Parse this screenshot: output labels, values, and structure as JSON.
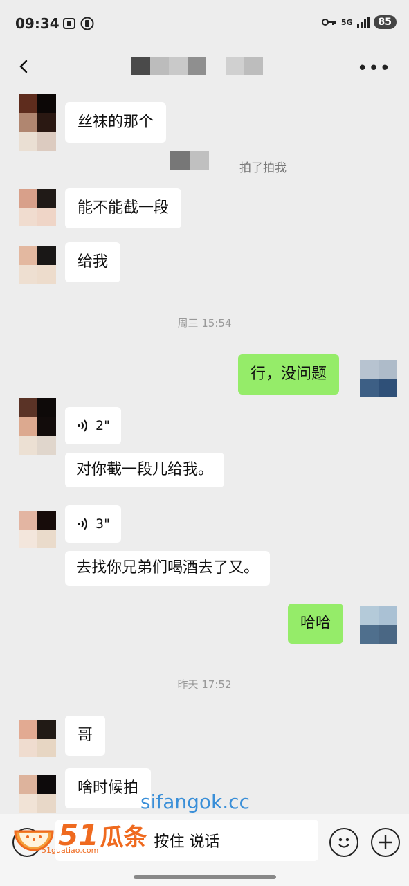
{
  "status": {
    "time": "09:34",
    "network": "5G",
    "battery": "85"
  },
  "header": {
    "title": ""
  },
  "messages": [
    {
      "type": "text",
      "side": "left",
      "text": "丝袜的那个"
    },
    {
      "type": "system",
      "text": "拍了拍我"
    },
    {
      "type": "text",
      "side": "left",
      "text": "能不能截一段"
    },
    {
      "type": "text",
      "side": "left",
      "text": "给我"
    },
    {
      "type": "timestamp",
      "text": "周三 15:54"
    },
    {
      "type": "text",
      "side": "right",
      "text": "行，没问题"
    },
    {
      "type": "voice",
      "side": "left",
      "duration": "2\"",
      "transcript": "对你截一段儿给我。"
    },
    {
      "type": "voice",
      "side": "left",
      "duration": "3\"",
      "transcript": "去找你兄弟们喝酒去了又。"
    },
    {
      "type": "text",
      "side": "right",
      "text": "哈哈"
    },
    {
      "type": "timestamp",
      "text": "昨天 17:52"
    },
    {
      "type": "text",
      "side": "left",
      "text": "哥"
    },
    {
      "type": "text",
      "side": "left",
      "text": "啥时候拍"
    }
  ],
  "input_bar": {
    "hold_to_talk": "按住 说话"
  },
  "watermark": {
    "url": "sifangok.cc",
    "logo_number": "51",
    "logo_text": "瓜条",
    "logo_sub": "51guatiao.com"
  },
  "colors": {
    "background": "#ededed",
    "my_bubble": "#95ec69",
    "their_bubble": "#ffffff",
    "watermark_url": "#3a8fd8",
    "logo": "#ef6a1f"
  },
  "icons": [
    "back-icon",
    "more-icon",
    "voice-wave-icon",
    "voice-toggle-icon",
    "emoji-icon",
    "plus-icon"
  ]
}
